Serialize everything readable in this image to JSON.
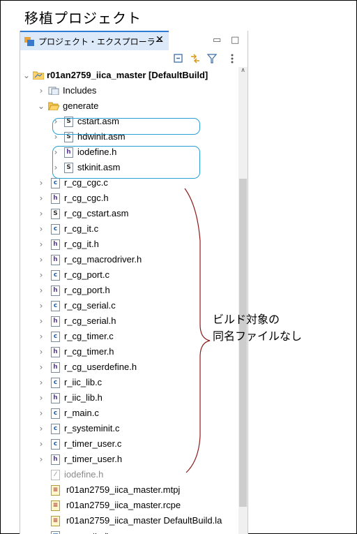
{
  "caption": "移植プロジェクト",
  "view_tab": {
    "label": "プロジェクト・エクスプローラー",
    "close": "✕"
  },
  "window_controls": {
    "minimize": "▭",
    "maximize": "□"
  },
  "tree": {
    "project": "r01an2759_iica_master [DefaultBuild]",
    "includes": "Includes",
    "generate": "generate",
    "generate_children": [
      {
        "name": "cstart.asm",
        "type": "S"
      },
      {
        "name": "hdwinit.asm",
        "type": "S"
      },
      {
        "name": "iodefine.h",
        "type": "h"
      },
      {
        "name": "stkinit.asm",
        "type": "S"
      }
    ],
    "files": [
      {
        "name": "r_cg_cgc.c",
        "type": "c"
      },
      {
        "name": "r_cg_cgc.h",
        "type": "h"
      },
      {
        "name": "r_cg_cstart.asm",
        "type": "S"
      },
      {
        "name": "r_cg_it.c",
        "type": "c"
      },
      {
        "name": "r_cg_it.h",
        "type": "h"
      },
      {
        "name": "r_cg_macrodriver.h",
        "type": "h"
      },
      {
        "name": "r_cg_port.c",
        "type": "c"
      },
      {
        "name": "r_cg_port.h",
        "type": "h"
      },
      {
        "name": "r_cg_serial.c",
        "type": "c"
      },
      {
        "name": "r_cg_serial.h",
        "type": "h"
      },
      {
        "name": "r_cg_timer.c",
        "type": "c"
      },
      {
        "name": "r_cg_timer.h",
        "type": "h"
      },
      {
        "name": "r_cg_userdefine.h",
        "type": "h"
      },
      {
        "name": "r_iic_lib.c",
        "type": "c"
      },
      {
        "name": "r_iic_lib.h",
        "type": "h"
      },
      {
        "name": "r_main.c",
        "type": "c"
      },
      {
        "name": "r_systeminit.c",
        "type": "c"
      },
      {
        "name": "r_timer_user.c",
        "type": "c"
      },
      {
        "name": "r_timer_user.h",
        "type": "h"
      }
    ],
    "excluded_file": "iodefine.h",
    "project_files": [
      "r01an2759_iica_master.mtpj",
      "r01an2759_iica_master.rcpe",
      "r01an2759_iica_master DefaultBuild.la"
    ],
    "code_gen": "コード生成"
  },
  "annotation": {
    "line1": "ビルド対象の",
    "line2": "同名ファイルなし"
  },
  "colors": {
    "callout": "#2a9fd6",
    "brace": "#8b1a1a",
    "tab_accent": "#2e7bd6"
  }
}
